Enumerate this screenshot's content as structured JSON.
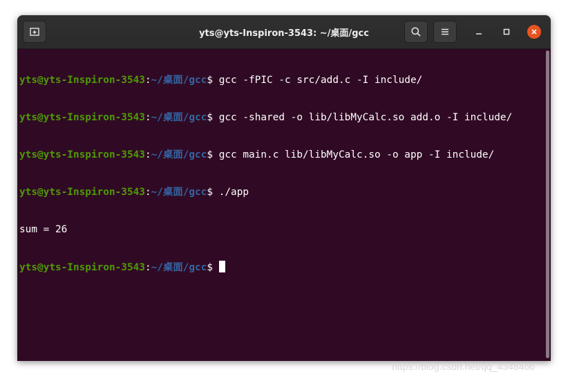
{
  "window": {
    "title": "yts@yts-Inspiron-3543: ~/桌面/gcc",
    "new_tab_icon": "new-tab-icon",
    "search_icon": "search-icon",
    "menu_icon": "hamburger-menu-icon",
    "minimize_icon": "minimize-icon",
    "maximize_icon": "maximize-icon",
    "close_icon": "close-icon",
    "close_color": "#e95420"
  },
  "terminal": {
    "background": "#300a24",
    "prompt_user": "yts@yts-Inspiron-3543",
    "prompt_colon": ":",
    "prompt_path": "~/桌面/gcc",
    "prompt_dollar": "$ ",
    "user_color": "#4e9a06",
    "path_color": "#3465a4",
    "lines": [
      {
        "type": "command",
        "text": "gcc -fPIC -c src/add.c -I include/"
      },
      {
        "type": "command",
        "text": "gcc -shared -o lib/libMyCalc.so add.o -I include/"
      },
      {
        "type": "command",
        "text": "gcc main.c lib/libMyCalc.so -o app -I include/"
      },
      {
        "type": "command",
        "text": "./app"
      },
      {
        "type": "output",
        "text": "sum = 26"
      },
      {
        "type": "prompt",
        "text": ""
      }
    ]
  },
  "watermark": "https://blog.csdn.net/qq_4348466"
}
